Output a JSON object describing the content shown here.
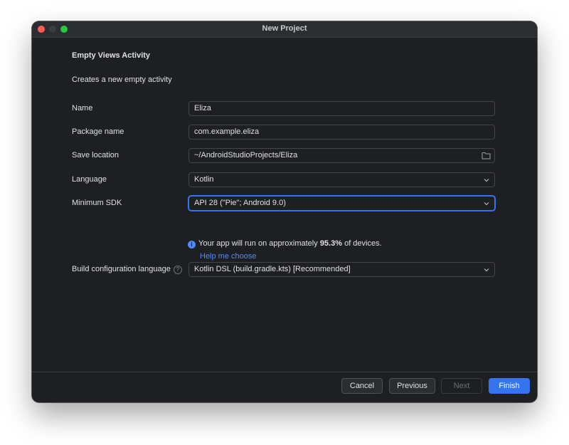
{
  "window": {
    "title": "New Project"
  },
  "header": {
    "template": "Empty Views Activity",
    "description": "Creates a new empty activity"
  },
  "form": {
    "name": {
      "label": "Name",
      "value": "Eliza"
    },
    "package": {
      "label": "Package name",
      "value": "com.example.eliza"
    },
    "save_location": {
      "label": "Save location",
      "value": "~/AndroidStudioProjects/Eliza"
    },
    "language": {
      "label": "Language",
      "value": "Kotlin"
    },
    "min_sdk": {
      "label": "Minimum SDK",
      "value": "API 28 (\"Pie\"; Android 9.0)"
    },
    "build_config": {
      "label": "Build configuration language",
      "value": "Kotlin DSL (build.gradle.kts) [Recommended]"
    }
  },
  "info": {
    "prefix": "Your app will run on approximately ",
    "percent": "95.3%",
    "suffix": " of devices.",
    "help_link": "Help me choose"
  },
  "footer": {
    "cancel": "Cancel",
    "previous": "Previous",
    "next": "Next",
    "finish": "Finish"
  },
  "icons": {
    "info": "info-icon",
    "help": "question-icon",
    "folder": "folder-icon",
    "dropdown": "chevron-down-icon"
  },
  "colors": {
    "accent": "#3574f0",
    "link": "#548af7",
    "background": "#1e1f22"
  }
}
